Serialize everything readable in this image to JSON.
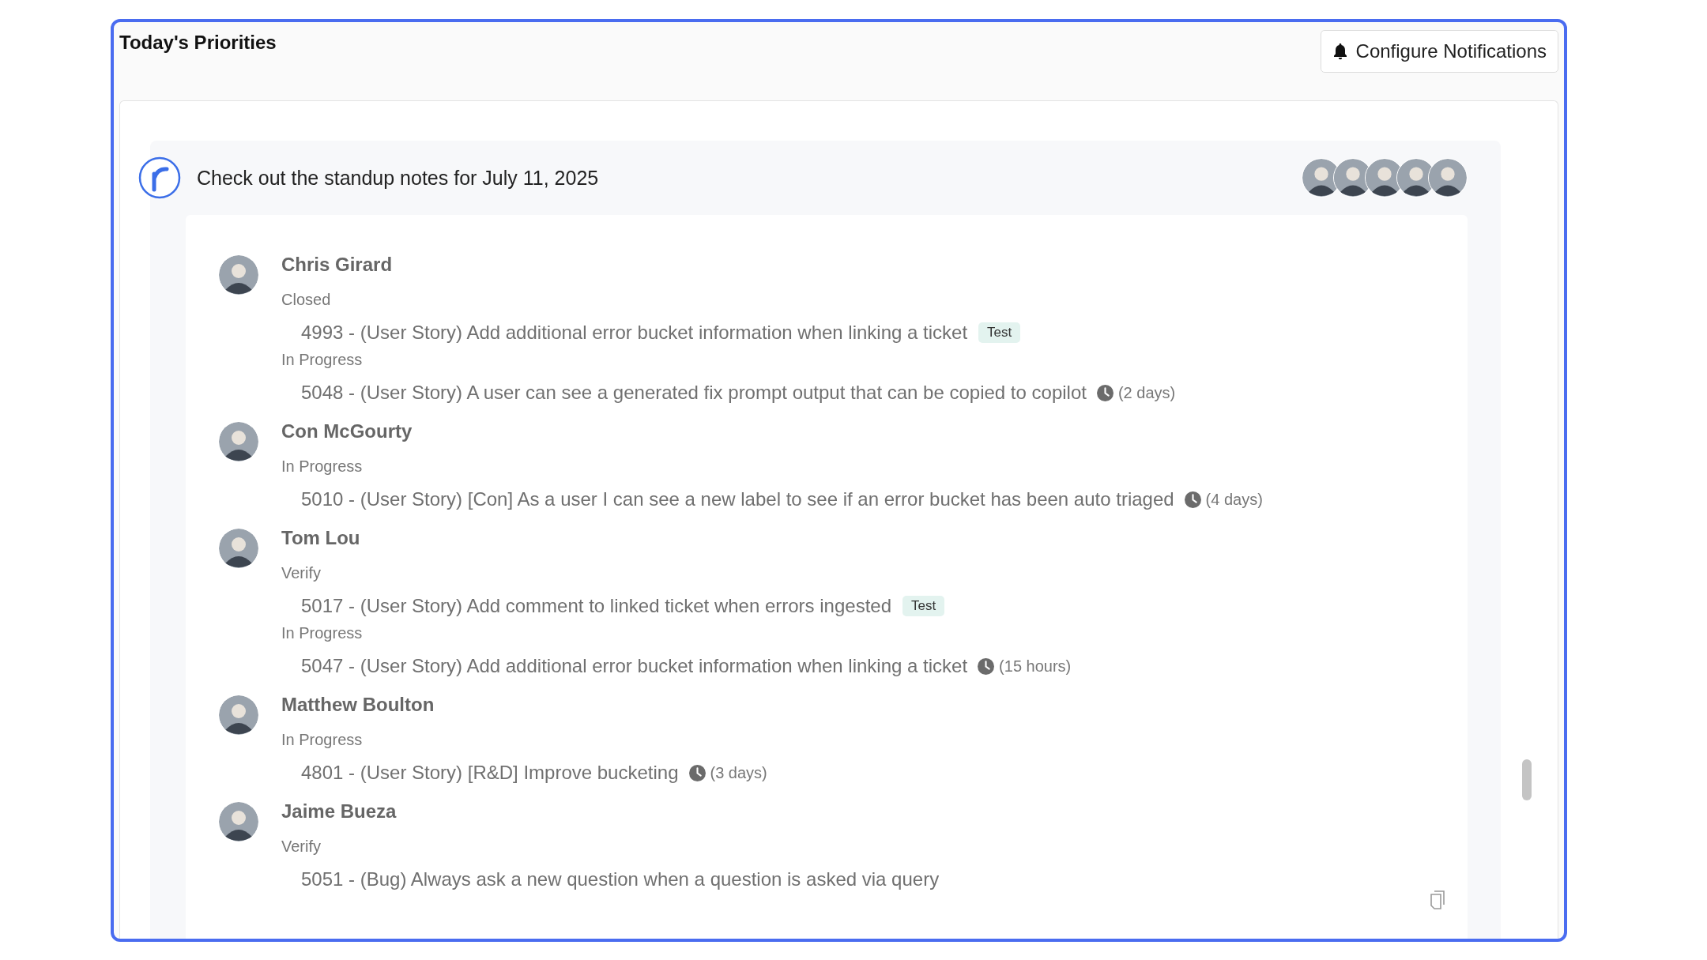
{
  "title": "Today's Priorities",
  "notify_button": "Configure Notifications",
  "standup": {
    "heading": "Check out the standup notes for July 11, 2025",
    "people": [
      {
        "name": "Chris Girard",
        "groups": [
          {
            "status": "Closed",
            "items": [
              {
                "text": "4993 - (User Story) Add additional error bucket information when linking a ticket",
                "tag": "Test"
              }
            ]
          },
          {
            "status": "In Progress",
            "items": [
              {
                "text": "5048 - (User Story) A user can see a generated fix prompt output that can be copied to copilot",
                "age": "(2 days)"
              }
            ]
          }
        ]
      },
      {
        "name": "Con McGourty",
        "groups": [
          {
            "status": "In Progress",
            "items": [
              {
                "text": "5010 - (User Story) [Con] As a user I can see a new label to see if an error bucket has been auto triaged",
                "age": "(4 days)"
              }
            ]
          }
        ]
      },
      {
        "name": "Tom Lou",
        "groups": [
          {
            "status": "Verify",
            "items": [
              {
                "text": "5017 - (User Story) Add comment to linked ticket when errors ingested",
                "tag": "Test"
              }
            ]
          },
          {
            "status": "In Progress",
            "items": [
              {
                "text": "5047 - (User Story) Add additional error bucket information when linking a ticket",
                "age": "(15 hours)"
              }
            ]
          }
        ]
      },
      {
        "name": "Matthew Boulton",
        "groups": [
          {
            "status": "In Progress",
            "items": [
              {
                "text": "4801 - (User Story) [R&D] Improve bucketing",
                "age": "(3 days)"
              }
            ]
          }
        ]
      },
      {
        "name": "Jaime Bueza",
        "groups": [
          {
            "status": "Verify",
            "items": [
              {
                "text": "5051 - (Bug) Always ask a new question when a question is asked via query"
              }
            ]
          }
        ]
      }
    ]
  }
}
